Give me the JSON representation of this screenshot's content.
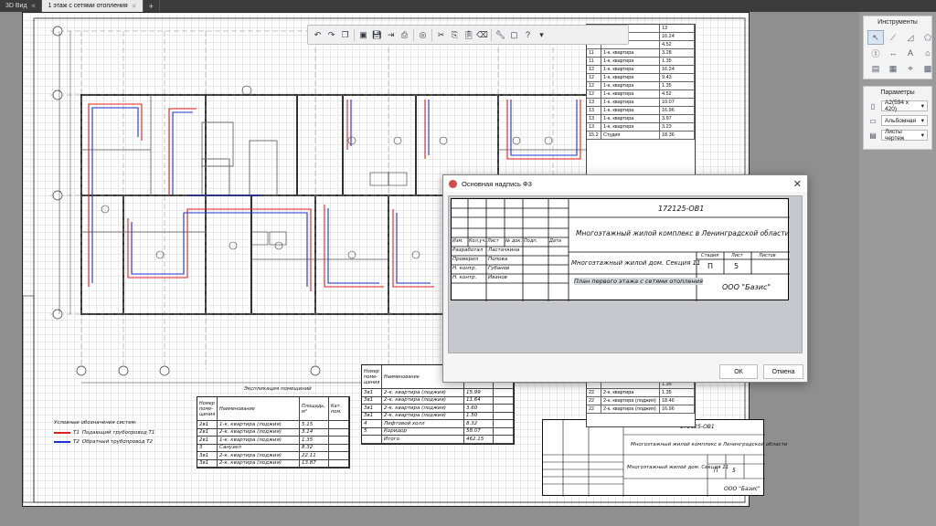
{
  "tabs": [
    {
      "label": "3D Вид",
      "active": false
    },
    {
      "label": "1 этаж с сетями отопления",
      "active": true
    }
  ],
  "toolbar": {
    "icons": [
      "undo",
      "redo",
      "layers",
      "open",
      "save",
      "export",
      "print",
      "3d",
      "cut",
      "copy",
      "paste",
      "erase",
      "wrench",
      "window",
      "help"
    ]
  },
  "rooms_table": {
    "rows": [
      [
        "",
        "",
        "13"
      ],
      [
        "",
        "",
        "16.24"
      ],
      [
        "",
        "",
        "4.52"
      ],
      [
        "11",
        "1-к. квартира",
        "3.28"
      ],
      [
        "11",
        "1-к. квартира",
        "1.35"
      ],
      [
        "12",
        "1-к. квартира",
        "16.24"
      ],
      [
        "12",
        "1-к. квартира",
        "9.43"
      ],
      [
        "12",
        "1-к. квартира",
        "1.35"
      ],
      [
        "12",
        "1-к. квартира",
        "4.52"
      ],
      [
        "13",
        "1-к. квартира",
        "10.07"
      ],
      [
        "13",
        "1-к. квартира",
        "16.96"
      ],
      [
        "13",
        "1-к. квартира",
        "3.97"
      ],
      [
        "13",
        "1-к. квартира",
        "3.23"
      ],
      [
        "15.2",
        "Студия",
        "18.36"
      ]
    ],
    "rows2": [
      [
        "",
        "",
        "1.35"
      ],
      [
        "22",
        "2-к. квартира",
        "1.35"
      ],
      [
        "22",
        "2-к. квартира (лоджия)",
        "18.46"
      ],
      [
        "22",
        "2-к. квартира (лоджия)",
        "16.96"
      ]
    ]
  },
  "tools_panel": {
    "title": "Инструменты",
    "tools": [
      "cursor",
      "line",
      "polyline",
      "shape",
      "circle-text",
      "dimension",
      "text",
      "note",
      "view",
      "table",
      "leader",
      "grid"
    ]
  },
  "params_panel": {
    "title": "Параметры",
    "format": "A2(594 x 420)",
    "orientation": "Альбомная",
    "sheets": "Листы чертеж"
  },
  "dialog": {
    "title": "Основная надпись Ф3",
    "code": "172125-ОВ1",
    "project": "Многоэтажный жилой комплекс в Ленинградской области",
    "building": "Многоэтажный жилой дом. Секция 11",
    "sheet_title": "План первого этажа с сетями отопления",
    "org": "ООО \"Базис\"",
    "stage_label": "Стадия",
    "sheet_label": "Лист",
    "sheets_label": "Листов",
    "stage": "П",
    "sheet_num": "5",
    "head": [
      "Изм.",
      "Кол.уч.",
      "Лист",
      "№ док.",
      "Подп.",
      "Дата"
    ],
    "roles": [
      [
        "Разработал",
        "Ластачкина"
      ],
      [
        "Проверил",
        "Попова"
      ],
      [
        "Н. контр.",
        "Губанов"
      ],
      [
        "Н. контр.",
        "Иванов"
      ]
    ],
    "ok": "ОК",
    "cancel": "Отмена"
  },
  "sheet": {
    "legend_title": "Условные обозначения систем:",
    "legend": [
      {
        "code": "Т1",
        "text": "Подающий трубопровод Т1",
        "color": "#e02020"
      },
      {
        "code": "Т2",
        "text": "Обратный трубопровод Т2",
        "color": "#2030d0"
      }
    ],
    "expl_title": "Экспликация помещений",
    "expl_head": [
      "Номер поме- щения",
      "Наименование",
      "Площадь, м²",
      "Кат. пом."
    ],
    "expl1": [
      [
        "2в1",
        "1-к. квартира (лоджия)",
        "5.15",
        ""
      ],
      [
        "2в1",
        "2-к. квартира (лоджия)",
        "3.14",
        ""
      ],
      [
        "2в1",
        "1-к. квартира (лоджия)",
        "1.35",
        ""
      ],
      [
        "3",
        "Санузел",
        "8.32",
        ""
      ],
      [
        "3в1",
        "2-к. квартира (лоджия)",
        "22.11",
        ""
      ],
      [
        "3в1",
        "2-к. квартира (лоджия)",
        "13.87",
        ""
      ]
    ],
    "expl2": [
      [
        "3в1",
        "2-к. квартира (лоджия)",
        "15.99",
        ""
      ],
      [
        "3в1",
        "2-к. квартира (лоджия)",
        "11.64",
        ""
      ],
      [
        "3в1",
        "2-к. квартира (лоджия)",
        "3.60",
        ""
      ],
      [
        "3в1",
        "2-к. квартира (лоджия)",
        "1.50",
        ""
      ],
      [
        "4",
        "Лифтовой холл",
        "8.32",
        ""
      ],
      [
        "5",
        "Коридор",
        "58.07",
        ""
      ],
      [
        "",
        "Итого",
        "462.15",
        ""
      ]
    ],
    "tb_code": "172125-ОВ1",
    "tb_project": "Многоэтажный жилой комплекс в Ленинградской области",
    "tb_building": "Многоэтажный жилой дом. Секция 11",
    "tb_stage": "П",
    "tb_sheet": "5",
    "tb_org": "ООО \"Базис\"",
    "colors": {
      "supply": "#e02020",
      "return": "#2030d0"
    }
  }
}
